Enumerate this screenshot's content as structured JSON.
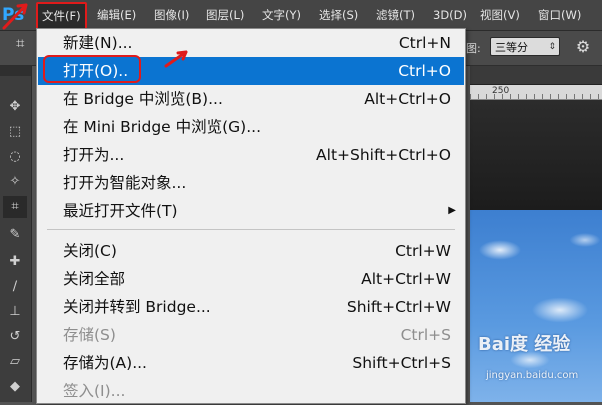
{
  "app": {
    "logo": "Ps"
  },
  "menubar": {
    "items": [
      {
        "label": "文件(F)"
      },
      {
        "label": "编辑(E)"
      },
      {
        "label": "图像(I)"
      },
      {
        "label": "图层(L)"
      },
      {
        "label": "文字(Y)"
      },
      {
        "label": "选择(S)"
      },
      {
        "label": "滤镜(T)"
      },
      {
        "label": "3D(D)"
      },
      {
        "label": "视图(V)"
      },
      {
        "label": "窗口(W)"
      }
    ]
  },
  "options_bar": {
    "label": "图:",
    "select_value": "三等分"
  },
  "ruler": {
    "label": "250"
  },
  "file_menu": {
    "items": [
      {
        "label": "新建(N)...",
        "shortcut": "Ctrl+N"
      },
      {
        "label": "打开(O)..",
        "shortcut": "Ctrl+O"
      },
      {
        "label": "在 Bridge 中浏览(B)...",
        "shortcut": "Alt+Ctrl+O"
      },
      {
        "label": "在 Mini Bridge 中浏览(G)...",
        "shortcut": ""
      },
      {
        "label": "打开为...",
        "shortcut": "Alt+Shift+Ctrl+O"
      },
      {
        "label": "打开为智能对象...",
        "shortcut": ""
      },
      {
        "label": "最近打开文件(T)",
        "shortcut": ""
      },
      {
        "label": "关闭(C)",
        "shortcut": "Ctrl+W"
      },
      {
        "label": "关闭全部",
        "shortcut": "Alt+Ctrl+W"
      },
      {
        "label": "关闭并转到 Bridge...",
        "shortcut": "Shift+Ctrl+W"
      },
      {
        "label": "存储(S)",
        "shortcut": "Ctrl+S"
      },
      {
        "label": "存储为(A)...",
        "shortcut": "Shift+Ctrl+S"
      },
      {
        "label": "签入(I)...",
        "shortcut": ""
      }
    ]
  },
  "watermark": {
    "logo": "Bai度 经验",
    "url": "jingyan.baidu.com"
  },
  "colors": {
    "selection": "#0b74d1",
    "annotation": "#e01b1b",
    "menu_bg": "#f0f0f0"
  }
}
